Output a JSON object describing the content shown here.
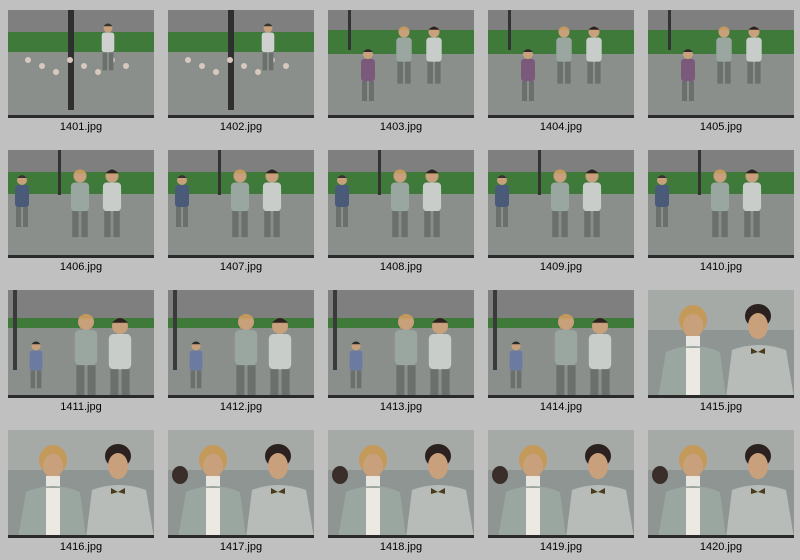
{
  "thumbnails": [
    {
      "filename": "1401.jpg",
      "scene": "plaza-wide"
    },
    {
      "filename": "1402.jpg",
      "scene": "plaza-wide"
    },
    {
      "filename": "1403.jpg",
      "scene": "plaza-walk"
    },
    {
      "filename": "1404.jpg",
      "scene": "plaza-walk"
    },
    {
      "filename": "1405.jpg",
      "scene": "plaza-walk"
    },
    {
      "filename": "1406.jpg",
      "scene": "couple-walk"
    },
    {
      "filename": "1407.jpg",
      "scene": "couple-walk"
    },
    {
      "filename": "1408.jpg",
      "scene": "couple-walk"
    },
    {
      "filename": "1409.jpg",
      "scene": "couple-walk"
    },
    {
      "filename": "1410.jpg",
      "scene": "couple-walk"
    },
    {
      "filename": "1411.jpg",
      "scene": "couple-mid"
    },
    {
      "filename": "1412.jpg",
      "scene": "couple-mid"
    },
    {
      "filename": "1413.jpg",
      "scene": "couple-mid"
    },
    {
      "filename": "1414.jpg",
      "scene": "couple-mid"
    },
    {
      "filename": "1415.jpg",
      "scene": "couple-close"
    },
    {
      "filename": "1416.jpg",
      "scene": "couple-close"
    },
    {
      "filename": "1417.jpg",
      "scene": "couple-close"
    },
    {
      "filename": "1418.jpg",
      "scene": "couple-close"
    },
    {
      "filename": "1419.jpg",
      "scene": "couple-close"
    },
    {
      "filename": "1420.jpg",
      "scene": "couple-close"
    }
  ],
  "colors": {
    "background": "#c0c0c0",
    "wall": "#7f7f7f",
    "grass": "#3f7a3a",
    "pavement": "#8a8f8c",
    "jacket": "#9aa6a0",
    "skin": "#c9a07c",
    "hair_blonde": "#c49a5a",
    "hair_dark": "#2b2220"
  }
}
